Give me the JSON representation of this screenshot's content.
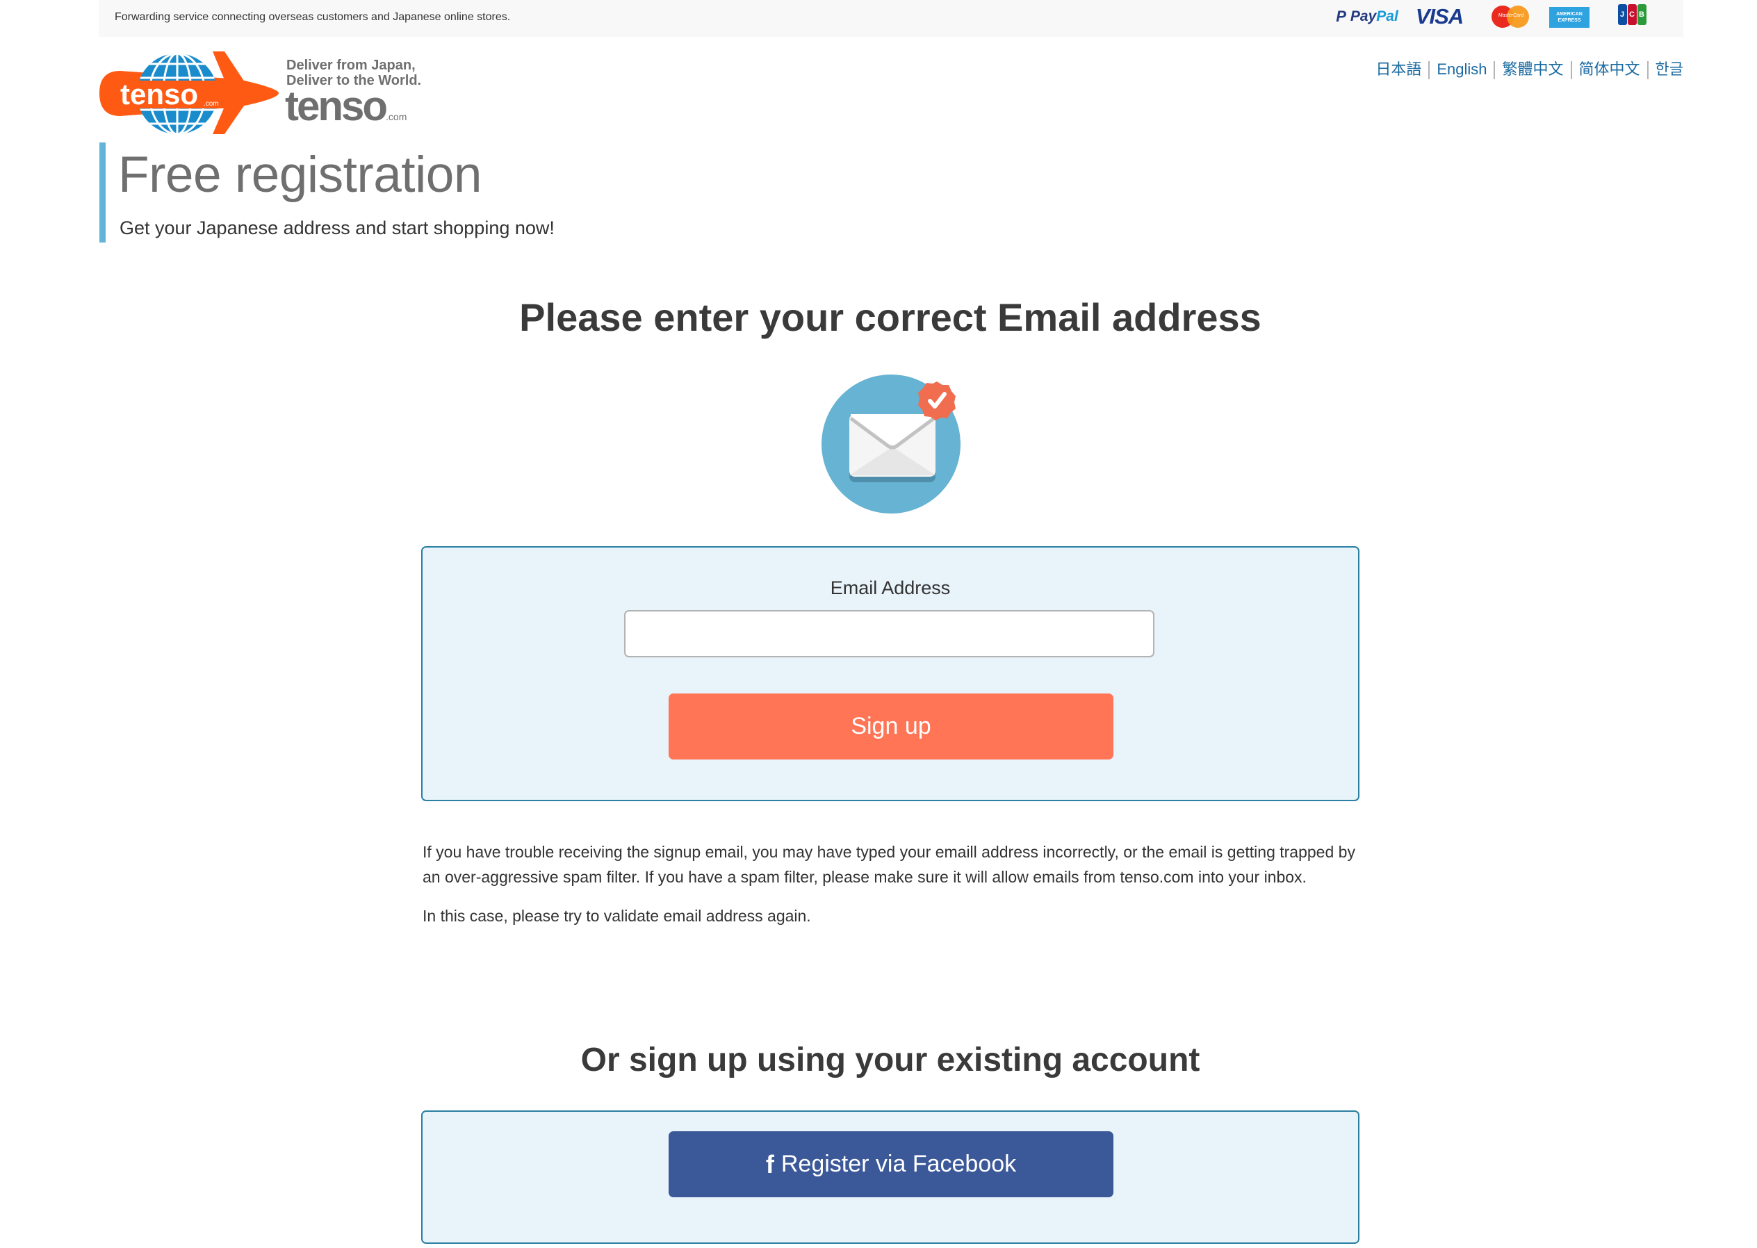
{
  "topbar": {
    "tagline": "Forwarding service connecting overseas customers and Japanese online stores.",
    "payment_methods": {
      "paypal_a": "Pay",
      "paypal_b": "Pal",
      "paypal_mark": "P",
      "visa": "VISA",
      "mastercard": "MasterCard",
      "amex_line1": "AMERICAN",
      "amex_line2": "EXPRESS",
      "jcb": [
        "J",
        "C",
        "B"
      ]
    }
  },
  "logo": {
    "mark_text": "tenso",
    "mark_com": ".com",
    "tagline_line1": "Deliver from Japan,",
    "tagline_line2": "Deliver to the World.",
    "wordmark": "tenso",
    "wordmark_com": ".com"
  },
  "languages": [
    {
      "label": "日本語"
    },
    {
      "label": "English"
    },
    {
      "label": "繁體中文"
    },
    {
      "label": "简体中文"
    },
    {
      "label": "한글"
    }
  ],
  "header": {
    "title": "Free registration",
    "subtitle": "Get your Japanese address and start shopping now!"
  },
  "email_section": {
    "heading": "Please enter your correct Email address",
    "icon": "envelope-check-icon",
    "field_label": "Email Address",
    "field_value": "",
    "field_placeholder": "",
    "submit_label": "Sign up"
  },
  "help": {
    "paragraph1": "If you have trouble receiving the signup email, you may have typed your emaill address incorrectly, or the email is getting trapped by an over-aggressive spam filter. If you have a spam filter, please make sure it will allow emails from tenso.com into your inbox.",
    "paragraph2": "In this case, please try to validate email address again."
  },
  "social_section": {
    "heading": "Or sign up using your existing account",
    "facebook_icon": "f",
    "facebook_label": "Register via Facebook"
  },
  "colors": {
    "accent_blue": "#62b5d9",
    "signup_button": "#ff7556",
    "facebook_button": "#3b5898",
    "panel_border": "#2a7fa3",
    "panel_bg": "#e8f3fa",
    "link": "#1a6aa0",
    "brand_orange": "#ff5a14"
  }
}
